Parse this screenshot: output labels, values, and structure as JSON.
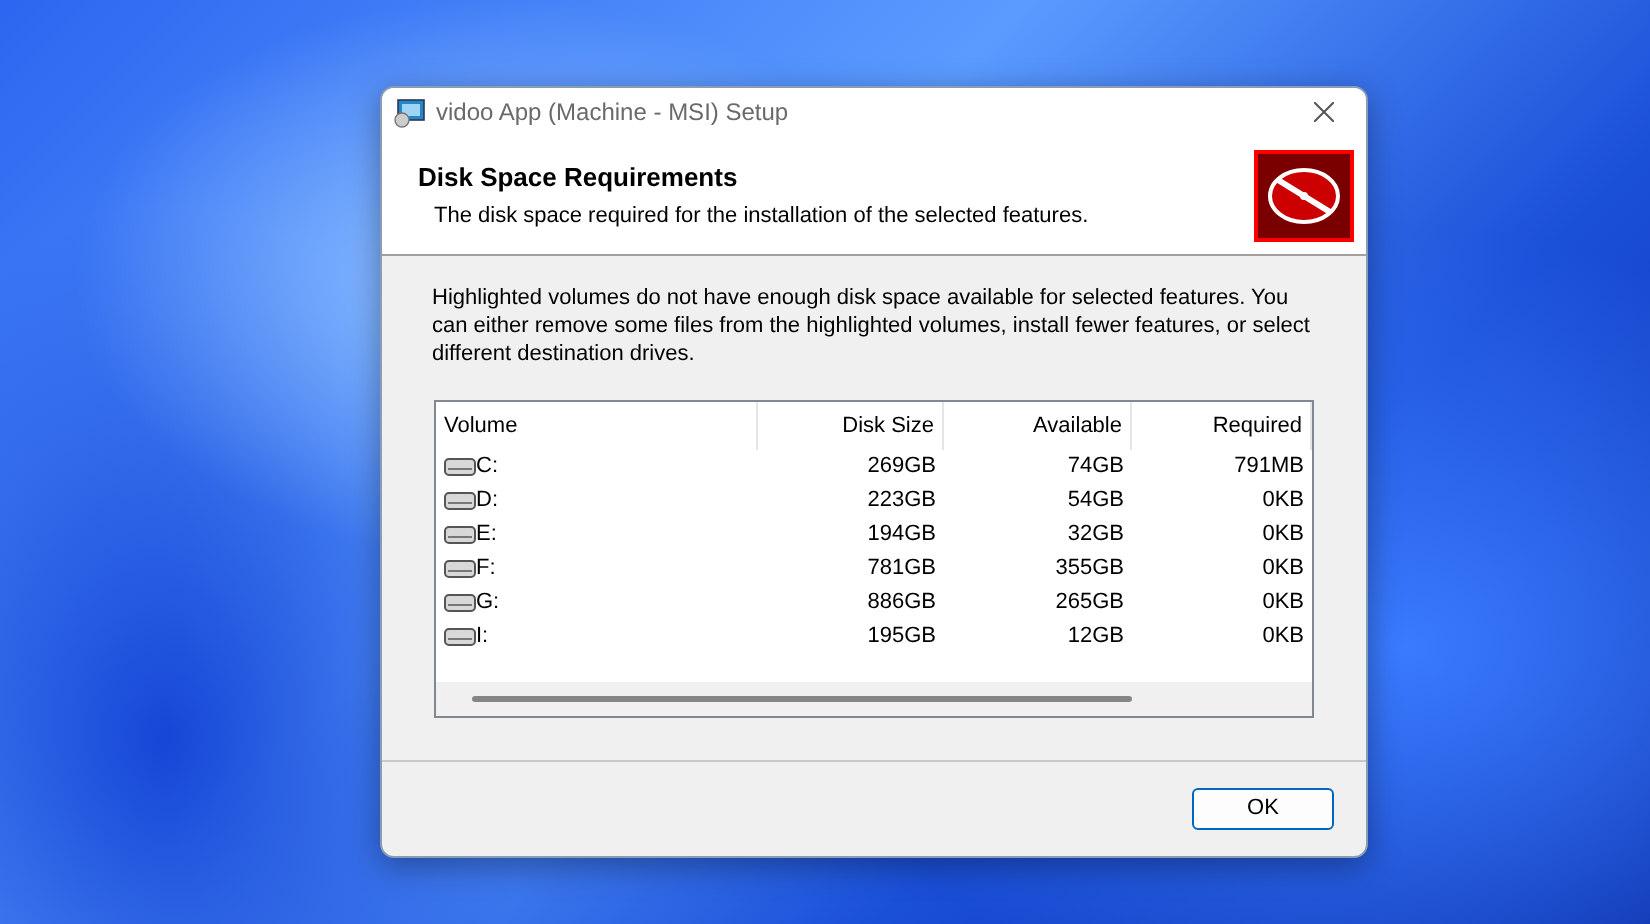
{
  "window": {
    "title": "vidoo App (Machine - MSI) Setup"
  },
  "header": {
    "title": "Disk Space Requirements",
    "subtitle": "The disk space required for the installation of the selected features."
  },
  "description": "Highlighted volumes do not have enough disk space available for selected features. You can either remove some files from the highlighted volumes, install fewer features, or select different destination drives.",
  "table": {
    "columns": [
      "Volume",
      "Disk Size",
      "Available",
      "Required"
    ],
    "rows": [
      {
        "volume": "C:",
        "disk_size": "269GB",
        "available": "74GB",
        "required": "791MB"
      },
      {
        "volume": "D:",
        "disk_size": "223GB",
        "available": "54GB",
        "required": "0KB"
      },
      {
        "volume": "E:",
        "disk_size": "194GB",
        "available": "32GB",
        "required": "0KB"
      },
      {
        "volume": "F:",
        "disk_size": "781GB",
        "available": "355GB",
        "required": "0KB"
      },
      {
        "volume": "G:",
        "disk_size": "886GB",
        "available": "265GB",
        "required": "0KB"
      },
      {
        "volume": "I:",
        "disk_size": "195GB",
        "available": "12GB",
        "required": "0KB"
      }
    ]
  },
  "buttons": [
    "OK"
  ]
}
